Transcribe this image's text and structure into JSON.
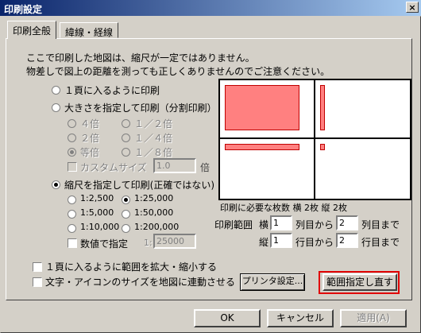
{
  "window": {
    "title": "印刷設定",
    "close_glyph": "×"
  },
  "tabs": [
    {
      "label": "印刷全般",
      "active": true
    },
    {
      "label": "緯線・経線",
      "active": false
    }
  ],
  "notice": {
    "line1": "ここで印刷した地図は、縮尺が一定ではありません。",
    "line2": "物差しで図上の距離を測っても正しくありませんのでご注意ください。"
  },
  "print_mode": {
    "fit_one_page": "１頁に入るように印刷",
    "by_size": "大きさを指定して印刷（分割印刷）",
    "size_options": [
      "４倍",
      "１／２倍",
      "２倍",
      "１／４倍",
      "等倍",
      "１／８倍"
    ],
    "custom_size_label": "カスタムサイズ",
    "custom_size_value": "1.0",
    "custom_size_unit": "倍",
    "by_scale": "縮尺を指定して印刷(正確ではない)",
    "scale_options": [
      "1:2,500",
      "1:25,000",
      "1:5,000",
      "1:50,000",
      "1:10,000",
      "1:200,000"
    ],
    "numeric_label": "数値で指定",
    "numeric_prefix": "1:",
    "numeric_value": "25000"
  },
  "preview": {
    "summary": "印刷に必要な枚数 横 2枚 縦 2枚"
  },
  "range": {
    "label": "印刷範囲",
    "horizontal": "横",
    "h_from": "1",
    "col_from": "列目から",
    "h_to": "2",
    "col_to": "列目まで",
    "vertical": "縦",
    "v_from": "1",
    "row_from": "行目から",
    "v_to": "2",
    "row_to": "行目まで"
  },
  "options": {
    "fit_zoom": "１頁に入るように範囲を拡大・縮小する",
    "link_icon_size": "文字・アイコンのサイズを地図に連動させる"
  },
  "buttons": {
    "printer_settings": "プリンタ設定...",
    "reset_range": "範囲指定し直す",
    "ok": "OK",
    "cancel": "キャンセル",
    "apply": "適用(A)"
  },
  "colors": {
    "highlight": "#e00000",
    "preview_block": "#ff8080",
    "title_bar": "#0a246a"
  }
}
